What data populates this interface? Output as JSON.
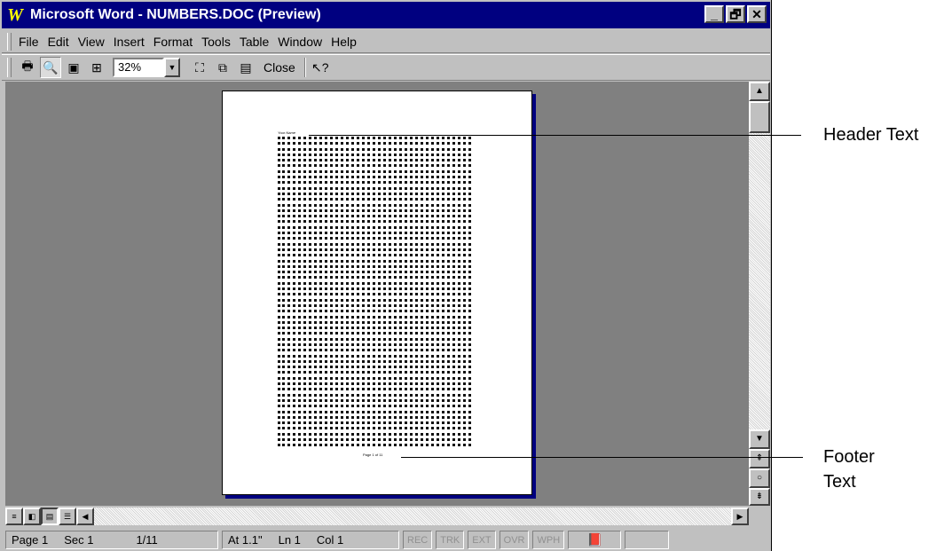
{
  "window": {
    "title": "Microsoft Word - NUMBERS.DOC (Preview)",
    "app_icon_glyph": "W",
    "controls": {
      "minimize": "_",
      "restore": "🗗",
      "close": "✕"
    }
  },
  "menu": [
    "File",
    "Edit",
    "View",
    "Insert",
    "Format",
    "Tools",
    "Table",
    "Window",
    "Help"
  ],
  "toolbar": {
    "zoom_value": "32%",
    "close_label": "Close"
  },
  "page": {
    "header_text": "Your Name",
    "footer_text": "Page 1 of 11"
  },
  "status": {
    "page": "Page 1",
    "sec": "Sec 1",
    "pages": "1/11",
    "at": "At 1.1\"",
    "ln": "Ln 1",
    "col": "Col 1",
    "indicators": [
      "REC",
      "TRK",
      "EXT",
      "OVR",
      "WPH"
    ]
  },
  "callouts": {
    "header": "Header Text",
    "footer_line1": "Footer",
    "footer_line2": "Text"
  }
}
